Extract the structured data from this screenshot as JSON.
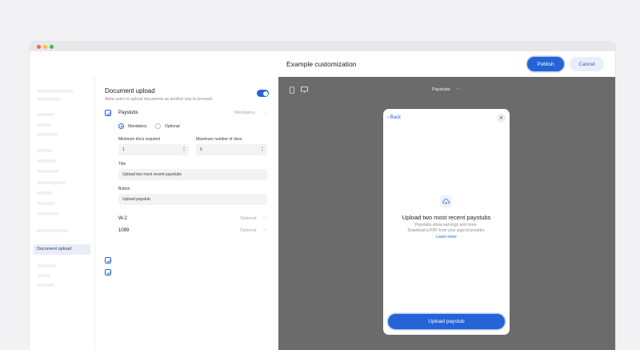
{
  "header": {
    "title": "Example customization",
    "publish_label": "Publish",
    "cancel_label": "Cancel"
  },
  "sidebar": {
    "active_item": "Document upload"
  },
  "settings": {
    "section_title": "Document upload",
    "section_description": "Allow users to upload documents as another way to proceed.",
    "enabled": true,
    "documents": [
      {
        "name": "Paystubs",
        "requirement": "Mandatory",
        "checked": true,
        "expanded": true
      },
      {
        "name": "W-2",
        "requirement": "Optional",
        "checked": true,
        "expanded": false
      },
      {
        "name": "1099",
        "requirement": "Optional",
        "checked": true,
        "expanded": false
      }
    ],
    "paystubs": {
      "radio_mandatory": "Mandatory",
      "radio_optional": "Optional",
      "selected": "Mandatory",
      "min_docs_label": "Minimum docs required",
      "min_docs_value": "1",
      "max_docs_label": "Maximum number of docs",
      "max_docs_value": "5",
      "title_label": "Title",
      "title_value": "Upload two most recent paystubs",
      "button_label": "Button",
      "button_value": "Upload paystub"
    }
  },
  "preview": {
    "selected_doc": "Paystubs",
    "back_label": "Back",
    "title": "Upload two most recent paystubs",
    "description_line1": "Paystubs show earnings and more.",
    "description_line2": "Download a PDF from your payroll provider.",
    "learn_more": "Learn more",
    "button": "Upload paystub"
  },
  "colors": {
    "accent": "#2563d6",
    "preview_bg": "#6b6b6b"
  }
}
